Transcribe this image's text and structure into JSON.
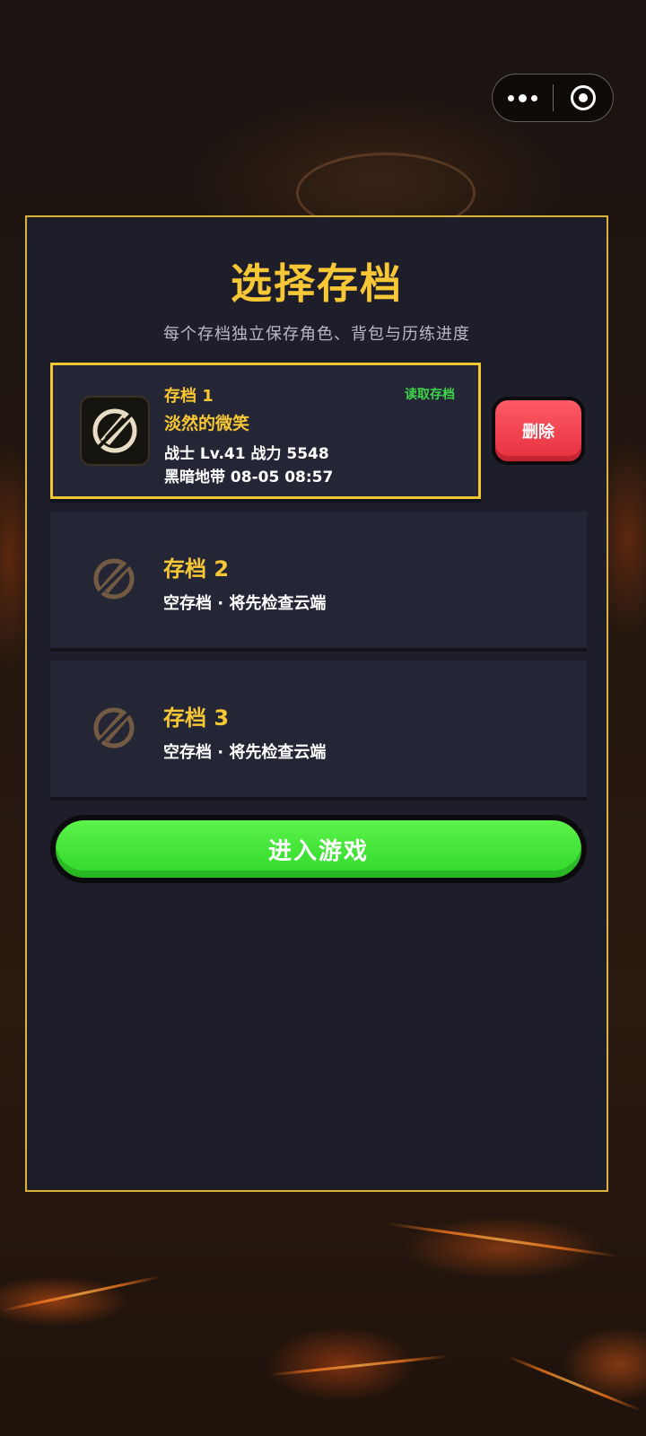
{
  "capsule": {
    "more_icon": "more-dots-icon",
    "close_icon": "target-circle-icon"
  },
  "panel": {
    "title": "选择存档",
    "subtitle": "每个存档独立保存角色、背包与历练进度"
  },
  "slots": [
    {
      "name": "存档 1",
      "action": "读取存档",
      "char_name": "淡然的微笑",
      "stats": "战士  Lv.41  战力 5548",
      "location": "黑暗地带  08-05 08:57",
      "icon": "slashed-scroll-icon",
      "selected": true
    },
    {
      "name": "存档 2",
      "empty_text": "空存档 · 将先检查云端",
      "icon": "slashed-scroll-icon"
    },
    {
      "name": "存档 3",
      "empty_text": "空存档 · 将先检查云端",
      "icon": "slashed-scroll-icon"
    }
  ],
  "buttons": {
    "delete": "删除",
    "enter": "进入游戏"
  },
  "colors": {
    "accent_gold": "#f7c735",
    "panel_border": "#d9b33a",
    "load_green": "#3fd44a",
    "delete_red": "#e5303f",
    "enter_green": "#2fd82a"
  }
}
